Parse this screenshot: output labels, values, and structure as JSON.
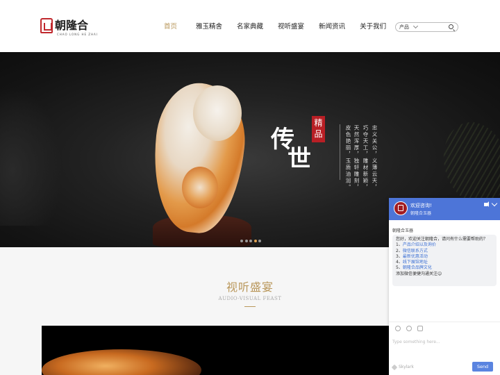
{
  "brand": {
    "logo_text": "朝隆合",
    "logo_sub": "CHAO LONG HE ZHAI"
  },
  "nav": {
    "items": [
      "首页",
      "雅玉精舍",
      "名家典藏",
      "视听盛宴",
      "新闻资讯",
      "关于我们"
    ],
    "active_index": 0
  },
  "search": {
    "category": "产品",
    "placeholder": ""
  },
  "banner": {
    "char1": "传",
    "char2": "世",
    "seal": "精品",
    "poem_lines": [
      "忠义关公，义薄云天，",
      "巧夺天工，雕材新颖，",
      "天然浑厚，独轩雕刻，",
      "皮色艳丽，玉质油润。"
    ],
    "slide_count": 5,
    "active_slide": 4
  },
  "section": {
    "title": "视听盛宴",
    "subtitle": "AUDIO-VISUAL FEAST"
  },
  "chat": {
    "header_title": "欢迎咨询!",
    "header_sub": "朝隆合玉器",
    "sender_name": "朝隆合玉器",
    "greeting": "您好，欢迎关注朝隆合，请问有什么需要帮助的？",
    "options": [
      {
        "num": "1、",
        "text": "产品介绍以及询价"
      },
      {
        "num": "2、",
        "text": "微信联系方式"
      },
      {
        "num": "3、",
        "text": "最新优惠活动"
      },
      {
        "num": "4、",
        "text": "线下展馆地址"
      },
      {
        "num": "5、",
        "text": "朝隆合品牌文化"
      }
    ],
    "footer_note": "添加微信便捷沟通关注☺",
    "input_placeholder": "Type something here...",
    "powered_by": "Skylark",
    "send_label": "Send"
  },
  "colors": {
    "accent": "#b9975b",
    "chat_blue": "#4d75d8",
    "brand_red": "#b81f25"
  }
}
